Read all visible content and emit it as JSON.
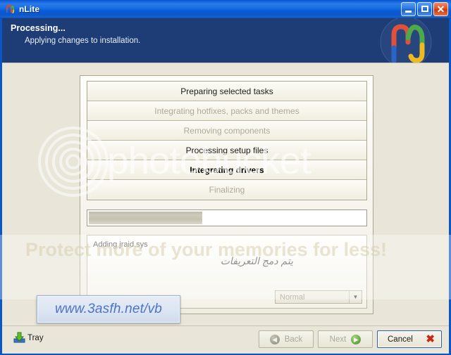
{
  "window": {
    "title": "nLite",
    "icon": "nlite-logo-icon",
    "buttons": {
      "minimize": "minimize-button",
      "maximize": "maximize-button",
      "close": "close-button",
      "close_glyph": "✕"
    }
  },
  "header": {
    "title": "Processing...",
    "subtitle": "Applying changes to installation.",
    "logo": "nlite-logo"
  },
  "tasks": [
    {
      "label": "Preparing selected tasks",
      "state": "done"
    },
    {
      "label": "Integrating hotfixes, packs and themes",
      "state": "muted"
    },
    {
      "label": "Removing components",
      "state": "muted"
    },
    {
      "label": "Processing setup files",
      "state": "done"
    },
    {
      "label": "Integrating drivers",
      "state": "active"
    },
    {
      "label": "Finalizing",
      "state": "muted"
    }
  ],
  "progress": {
    "percent": 41
  },
  "log": {
    "line": "Adding jraid.sys",
    "annotation": "يتم دمج التعريفات"
  },
  "priority_combo": {
    "value": "Normal",
    "arrow": "▼"
  },
  "footer": {
    "tray_label": "Tray",
    "back_label": "Back",
    "next_label": "Next",
    "cancel_label": "Cancel",
    "back_arrow": "◀",
    "next_arrow": "▶",
    "cancel_mark": "✖"
  },
  "watermarks": {
    "photobucket": "photobucket",
    "tagline": "Protect more of your memories for less!",
    "site": "www.3asfh.net/vb"
  },
  "colors": {
    "titlebar_blue": "#0A55D0",
    "header_navy": "#1E3C75",
    "body_beige": "#E9E5D8",
    "accent_red": "#C62A14",
    "site_blue": "#4A74C8"
  }
}
